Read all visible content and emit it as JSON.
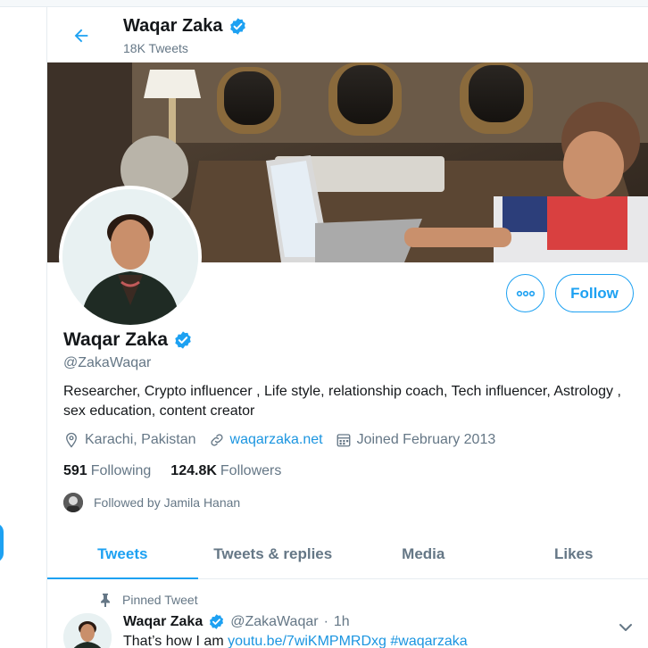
{
  "header": {
    "name": "Waqar Zaka",
    "tweet_count": "18K Tweets"
  },
  "profile": {
    "name": "Waqar Zaka",
    "handle": "@ZakaWaqar",
    "bio": "Researcher, Crypto influencer , Life style, relationship coach, Tech influencer, Astrology , sex education, content creator",
    "location": "Karachi, Pakistan",
    "website": "waqarzaka.net",
    "joined": "Joined February 2013",
    "following_count": "591",
    "following_label": "Following",
    "followers_count": "124.8K",
    "followers_label": "Followers",
    "followed_by": "Followed by Jamila Hanan"
  },
  "actions": {
    "follow_label": "Follow"
  },
  "tabs": [
    {
      "label": "Tweets",
      "active": true
    },
    {
      "label": "Tweets & replies",
      "active": false
    },
    {
      "label": "Media",
      "active": false
    },
    {
      "label": "Likes",
      "active": false
    }
  ],
  "tweet": {
    "pinned_label": "Pinned Tweet",
    "name": "Waqar Zaka",
    "handle": "@ZakaWaqar",
    "separator": "·",
    "time": "1h",
    "text_prefix": "That’s how I am",
    "link": "youtu.be/7wiKMPMRDxg",
    "hashtag": "#waqarzaka"
  },
  "colors": {
    "accent": "#1da1f2",
    "link": "#1b95e0",
    "muted": "#657786",
    "text": "#14171a",
    "verified": "#1da1f2"
  },
  "icons": [
    "back-arrow-icon",
    "verified-badge-icon",
    "location-icon",
    "link-icon",
    "calendar-icon",
    "more-icon",
    "pin-icon",
    "chevron-down-icon"
  ]
}
